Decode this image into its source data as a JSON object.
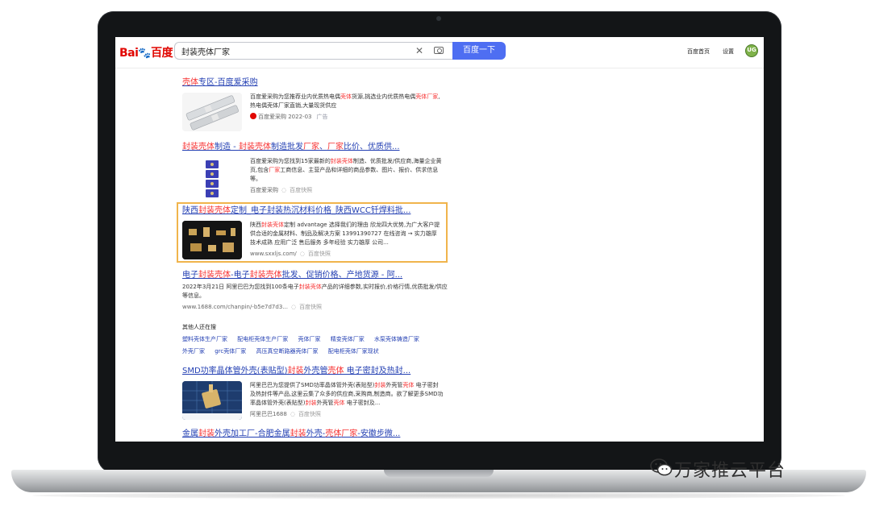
{
  "search": {
    "query": "封装壳体厂家",
    "button_label": "百度一下"
  },
  "logo": {
    "part1": "Bai",
    "part2": "du",
    "part3": "百度"
  },
  "nav": {
    "home": "百度首页",
    "settings": "设置",
    "avatar_text": "UG"
  },
  "results": [
    {
      "title_parts": [
        {
          "text": "壳体",
          "hl": true
        },
        {
          "text": "专区-百度爱采购",
          "hl": false
        }
      ],
      "desc": [
        {
          "text": "百度爱采购为您推荐业内优质热电偶",
          "hl": false
        },
        {
          "text": "壳体",
          "hl": true
        },
        {
          "text": "货源,挑选业内优质热电偶",
          "hl": false
        },
        {
          "text": "壳体",
          "hl": true
        },
        {
          "text": "厂家",
          "hl": true
        },
        {
          "text": ",热电偶壳体厂家直销,大量现货供应",
          "hl": false
        }
      ],
      "source": "百度爱采购 2022-03",
      "ad": "广告"
    },
    {
      "title_parts": [
        {
          "text": "封装壳体",
          "hl": true
        },
        {
          "text": "制造 - ",
          "hl": false
        },
        {
          "text": "封装壳体",
          "hl": true
        },
        {
          "text": "制造批发",
          "hl": false
        },
        {
          "text": "厂家",
          "hl": true
        },
        {
          "text": "、",
          "hl": false
        },
        {
          "text": "厂家",
          "hl": true
        },
        {
          "text": "比价、优质供...",
          "hl": false
        }
      ],
      "desc": [
        {
          "text": "百度爱采购为您找到15家最新的",
          "hl": false
        },
        {
          "text": "封装壳体",
          "hl": true
        },
        {
          "text": "制造、优质批发/供应商,海量企业黄页,包含",
          "hl": false
        },
        {
          "text": "厂家",
          "hl": true
        },
        {
          "text": "工商信息、主营产品和详细的商品参数、图片、报价、供求信息等。",
          "hl": false
        }
      ],
      "source": "百度爱采购",
      "kuai": "百度快照"
    },
    {
      "title_parts": [
        {
          "text": "陕西",
          "hl": false
        },
        {
          "text": "封装壳体",
          "hl": true
        },
        {
          "text": "定制_电子封装热沉材料价格_陕西WCC钎焊料批...",
          "hl": false
        }
      ],
      "desc": [
        {
          "text": "陕西",
          "hl": false
        },
        {
          "text": "封装壳体",
          "hl": true
        },
        {
          "text": "定制 advantage 选择我们的理由 欣龙四大优势,为广大客户提供合适的金属材料、制品及解决方案 13991390727 在线咨询 → 实力雄厚 技术成熟 应用广泛 售后服务 多年经验 实力雄厚 公司...",
          "hl": false
        }
      ],
      "source": "www.sxxljs.com/",
      "kuai": "百度快照"
    },
    {
      "title_parts": [
        {
          "text": "电子",
          "hl": false
        },
        {
          "text": "封装壳体",
          "hl": true
        },
        {
          "text": "-电子",
          "hl": false
        },
        {
          "text": "封装壳体",
          "hl": true
        },
        {
          "text": "批发、促销价格、产地货源 - 阿...",
          "hl": false
        }
      ],
      "desc": [
        {
          "text": "2022年3月21日 阿里巴巴为您找到100条电子",
          "hl": false
        },
        {
          "text": "封装壳体",
          "hl": true
        },
        {
          "text": "产品的详细参数,实时报价,价格行情,优质批发/供应等信息。",
          "hl": false
        }
      ],
      "source": "www.1688.com/chanpin/-b5e7d7d3...",
      "kuai": "百度快照"
    },
    {
      "title_parts": [
        {
          "text": "SMD功率晶体管外壳(表贴型)",
          "hl": false
        },
        {
          "text": "封装",
          "hl": true
        },
        {
          "text": "外壳管",
          "hl": false
        },
        {
          "text": "壳体",
          "hl": true
        },
        {
          "text": " 电子密封及热封...",
          "hl": false
        }
      ],
      "desc": [
        {
          "text": "阿里巴巴为您提供了SMD功率晶体管外壳(表贴型)",
          "hl": false
        },
        {
          "text": "封装",
          "hl": true
        },
        {
          "text": "外壳管",
          "hl": false
        },
        {
          "text": "壳体",
          "hl": true
        },
        {
          "text": " 电子密封及热封件等产品,这里云集了众多的供应商,采购商,制造商。欲了解更多SMD功率晶体管外壳(表贴型)",
          "hl": false
        },
        {
          "text": "封装",
          "hl": true
        },
        {
          "text": "外壳管",
          "hl": false
        },
        {
          "text": "壳体",
          "hl": true
        },
        {
          "text": " 电子密封及...",
          "hl": false
        }
      ],
      "source": "阿里巴巴1688",
      "kuai": "百度快照"
    },
    {
      "title_parts": [
        {
          "text": "金属",
          "hl": false
        },
        {
          "text": "封装",
          "hl": true
        },
        {
          "text": "外壳加工厂-合肥金属",
          "hl": false
        },
        {
          "text": "封装",
          "hl": true
        },
        {
          "text": "外壳-",
          "hl": false
        },
        {
          "text": "壳体",
          "hl": true
        },
        {
          "text": "厂家",
          "hl": true
        },
        {
          "text": "-安徽步微...",
          "hl": false
        }
      ]
    }
  ],
  "related": {
    "title": "其他人还在搜",
    "row1": [
      "塑料壳体生产厂家",
      "配电柜壳体生产厂家",
      "壳体厂家",
      "精变壳体厂家",
      "水泵壳体铸造厂家"
    ],
    "row2": [
      "外壳厂家",
      "grc壳体厂家",
      "高压真空断路器壳体厂家",
      "配电柜壳体厂家现状"
    ]
  },
  "watermark": "万家推云平台",
  "colors": {
    "link": "#2440b3",
    "highlight": "#f73131",
    "button": "#4e6ef2",
    "frame": "#f0b44c"
  }
}
